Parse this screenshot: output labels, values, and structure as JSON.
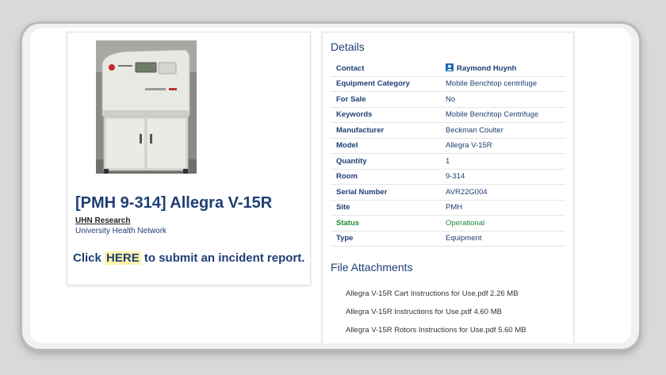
{
  "equipment": {
    "title": "[PMH 9-314] Allegra V-15R",
    "org_name": "UHN Research",
    "org_full": "University Health Network",
    "incident_prefix": "Click",
    "incident_link": "HERE",
    "incident_suffix": "to submit an incident report.",
    "photo_icon": "centrifuge-photo"
  },
  "details": {
    "heading": "Details",
    "rows": [
      {
        "label": "Contact",
        "value": "Raymond Huynh"
      },
      {
        "label": "Equipment Category",
        "value": "Mobile Benchtop centrifuge"
      },
      {
        "label": "For Sale",
        "value": "No"
      },
      {
        "label": "Keywords",
        "value": "Mobile Benchtop Centrifuge"
      },
      {
        "label": "Manufacturer",
        "value": "Beckman Coulter"
      },
      {
        "label": "Model",
        "value": "Allegra V-15R"
      },
      {
        "label": "Quantity",
        "value": "1"
      },
      {
        "label": "Room",
        "value": "9-314"
      },
      {
        "label": "Serial Number",
        "value": "AVR22G004"
      },
      {
        "label": "Site",
        "value": "PMH"
      },
      {
        "label": "Status",
        "value": "Operational"
      },
      {
        "label": "Type",
        "value": "Equipment"
      }
    ],
    "contact_icon": "person-icon"
  },
  "files": {
    "heading": "File Attachments",
    "items": [
      {
        "name": "Allegra V-15R Cart Instructions for Use.pdf",
        "size": "2.26 MB"
      },
      {
        "name": "Allegra V-15R Instructions for Use.pdf",
        "size": "4.60 MB"
      },
      {
        "name": "Allegra V-15R Rotors Instructions for Use.pdf",
        "size": "5.60 MB"
      }
    ]
  },
  "colors": {
    "heading": "#1e3f73",
    "status_ok": "#1f8a3a",
    "highlight": "#fff3b0",
    "background": "#d9d9d9"
  }
}
